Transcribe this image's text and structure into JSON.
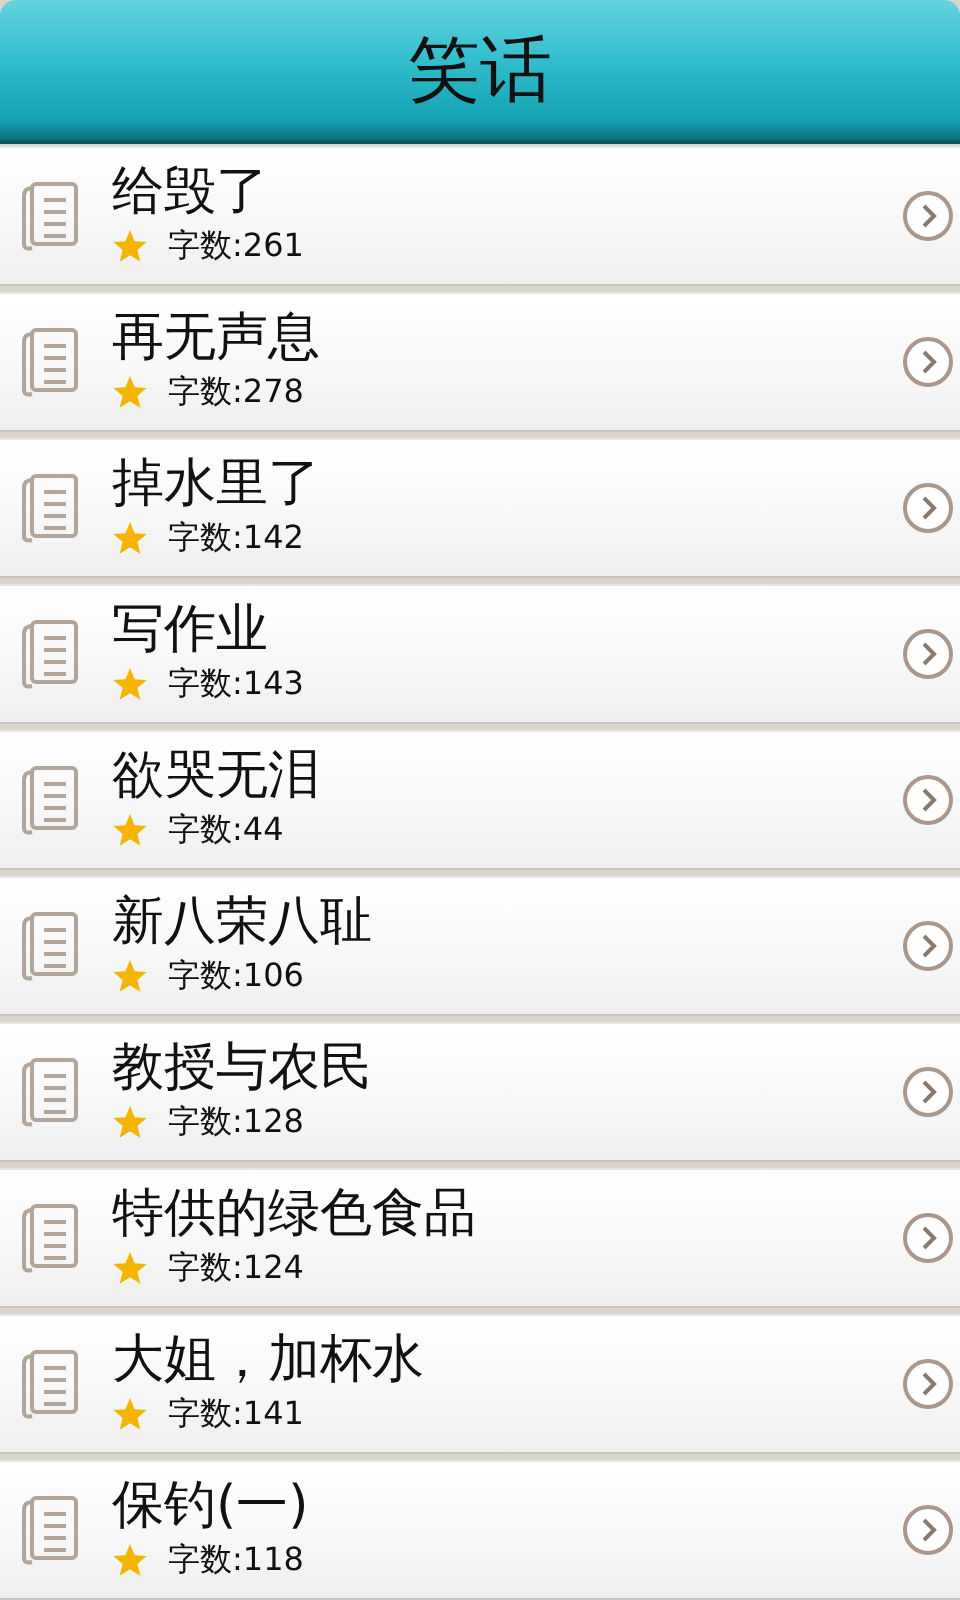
{
  "header": {
    "title": "笑话"
  },
  "items": [
    {
      "title": "给毁了",
      "count": "字数:261"
    },
    {
      "title": "再无声息",
      "count": "字数:278"
    },
    {
      "title": "掉水里了",
      "count": "字数:142"
    },
    {
      "title": "写作业",
      "count": "字数:143"
    },
    {
      "title": "欲哭无泪",
      "count": "字数:44"
    },
    {
      "title": "新八荣八耻",
      "count": "字数:106"
    },
    {
      "title": "教授与农民",
      "count": "字数:128"
    },
    {
      "title": "特供的绿色食品",
      "count": "字数:124"
    },
    {
      "title": "大姐，加杯水",
      "count": "字数:141"
    },
    {
      "title": "保钓(一)",
      "count": "字数:118"
    }
  ]
}
